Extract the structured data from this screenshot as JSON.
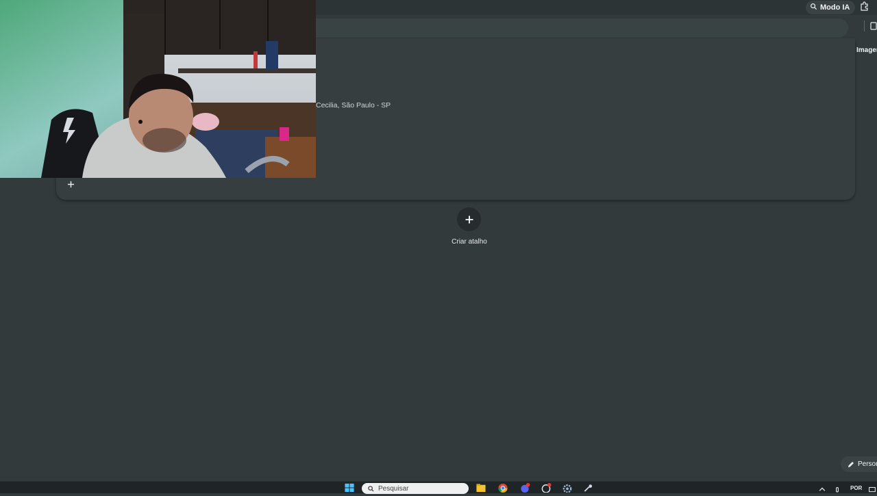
{
  "toolbar": {
    "ai_mode_label": "Modo IA",
    "ai_mode_icon": "sparkle-search-icon",
    "extensions_icon": "puzzle-icon"
  },
  "search_panel": {
    "images_label": "Imagen",
    "location_text": "Cecilia, São Paulo - SP",
    "add_icon": "plus-icon"
  },
  "shortcuts": {
    "create_label": "Criar atalho",
    "create_icon": "plus-icon"
  },
  "customize": {
    "label": "Persor",
    "icon": "pencil-icon"
  },
  "taskbar": {
    "search_placeholder": "Pesquisar",
    "language": "POR",
    "icons": [
      "windows-start-icon",
      "search-icon",
      "file-explorer-icon",
      "chrome-icon",
      "discord-icon",
      "chat-app-icon",
      "settings-icon",
      "steam-icon"
    ]
  },
  "colors": {
    "page_bg": "#323a3b",
    "panel_bg": "#363e3f",
    "taskbar_bg": "#1f2526"
  }
}
